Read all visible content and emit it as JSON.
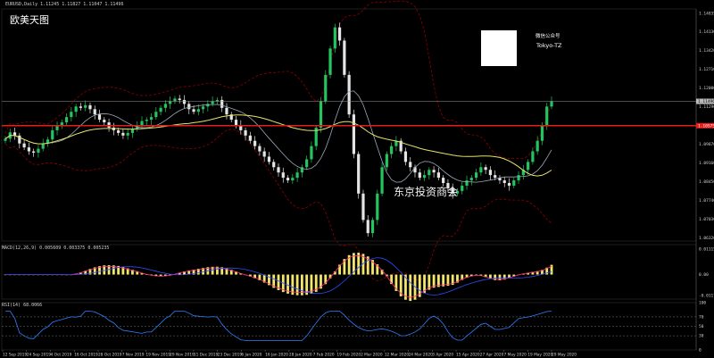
{
  "header": {
    "info": "EURUSD,Daily  1.11245  1.11827  1.11047  1.11496",
    "title": "欧美天图"
  },
  "qr": {
    "label": "微信公众号",
    "account": "Tokyo-TZ"
  },
  "watermark": "东京投资商会",
  "price_axis": {
    "ticks": [
      "1.14835",
      "1.14130",
      "1.13420",
      "1.12710",
      "1.12000",
      "1.11290",
      "1.10580",
      "1.09870",
      "1.09160",
      "1.08450",
      "1.07740",
      "1.07030",
      "1.06320"
    ],
    "current_price": "1.11496",
    "line_price": "1.10575"
  },
  "time_axis": {
    "ticks": [
      "12 Sep 2019",
      "24 Sep 2019",
      "4 Oct 2019",
      "16 Oct 2019",
      "28 Oct 2019",
      "7 Nov 2019",
      "19 Nov 2019",
      "29 Nov 2019",
      "11 Dec 2019",
      "23 Dec 2019",
      "6 Jan 2020",
      "16 Jan 2020",
      "28 Jan 2020",
      "7 Feb 2020",
      "19 Feb 2020",
      "2 Mar 2020",
      "12 Mar 2020",
      "24 Mar 2020",
      "3 Apr 2020",
      "15 Apr 2020",
      "27 Apr 2020",
      "7 May 2020",
      "19 May 2020",
      "29 May 2020"
    ]
  },
  "macd": {
    "label": "MACD(12,26,9) 0.005609 0.003375 0.005235",
    "ticks": [
      "0.011153",
      "0.00",
      "-0.011732"
    ]
  },
  "rsi": {
    "label": "RSI(14) 68.0066",
    "ticks": [
      "100",
      "70",
      "50",
      "30",
      "0"
    ]
  },
  "colors": {
    "bull": "#22c55e",
    "bear": "#e5e5e5",
    "band": "#8b0000",
    "ma_fast": "#9aa9b8",
    "ma_slow": "#e7e36a",
    "level": "#e11d1d",
    "macd_hist": "#f2e66b",
    "macd_signal": "#2f4cff",
    "macd_main": "#ff2d7a",
    "rsi": "#2f80ff"
  },
  "chart_data": {
    "type": "candlestick",
    "symbol": "EURUSD",
    "timeframe": "Daily",
    "close": [
      1.1008,
      1.1032,
      1.102,
      1.099,
      1.0975,
      1.096,
      1.0955,
      1.097,
      1.099,
      1.1005,
      1.104,
      1.1055,
      1.107,
      1.109,
      1.111,
      1.113,
      1.1125,
      1.1135,
      1.112,
      1.11,
      1.108,
      1.107,
      1.105,
      1.104,
      1.103,
      1.102,
      1.103,
      1.1045,
      1.106,
      1.1075,
      1.108,
      1.109,
      1.111,
      1.1125,
      1.114,
      1.115,
      1.116,
      1.1155,
      1.114,
      1.112,
      1.111,
      1.112,
      1.113,
      1.114,
      1.115,
      1.1155,
      1.1125,
      1.11,
      1.108,
      1.106,
      1.104,
      1.102,
      1.1,
      1.098,
      1.096,
      1.094,
      1.092,
      1.09,
      1.088,
      1.086,
      1.085,
      1.086,
      1.088,
      1.09,
      1.093,
      1.098,
      1.105,
      1.115,
      1.125,
      1.135,
      1.143,
      1.138,
      1.125,
      1.11,
      1.095,
      1.08,
      1.07,
      1.065,
      1.07,
      1.08,
      1.09,
      1.095,
      1.098,
      1.1,
      1.096,
      1.092,
      1.09,
      1.088,
      1.086,
      1.087,
      1.089,
      1.088,
      1.086,
      1.084,
      1.082,
      1.08,
      1.081,
      1.083,
      1.085,
      1.086,
      1.088,
      1.09,
      1.089,
      1.087,
      1.086,
      1.085,
      1.084,
      1.083,
      1.085,
      1.087,
      1.089,
      1.092,
      1.096,
      1.1,
      1.106,
      1.113,
      1.115
    ]
  }
}
